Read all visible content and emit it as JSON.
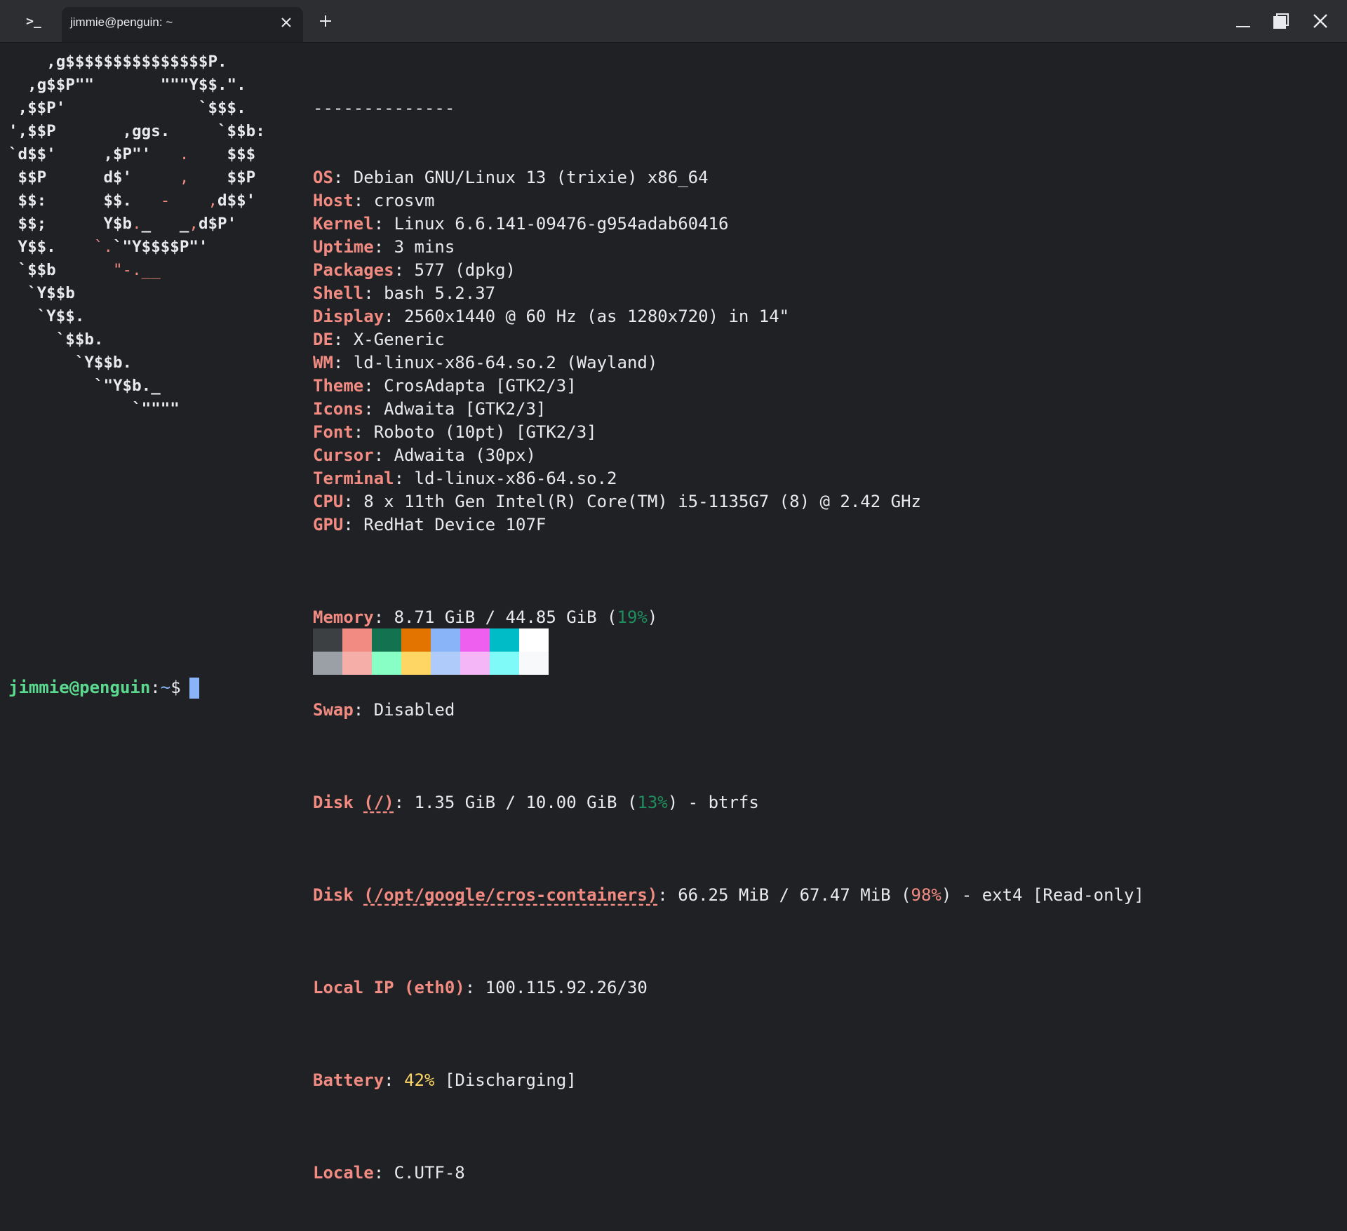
{
  "window": {
    "tab_title": "jimmie@penguin: ~",
    "app_icon": ">_"
  },
  "logo": {
    "lines": [
      "    ,g$$$$$$$$$$$$$$$P.",
      "  ,g$$P\"\"       \"\"\"Y$$.\".",
      " ,$$P'              `$$$.",
      "',$$P       ,ggs.     `$$b:",
      "`d$$'     ,$P\"'   .    $$$",
      " $$P      d$'     ,    $$P",
      " $$:      $$.   -    ,d$$'",
      " $$;      Y$b._   _,d$P'",
      " Y$$.    `.`\"Y$$$$P\"'",
      " `$$b      \"-.__",
      "  `Y$$b",
      "   `Y$$.",
      "     `$$b.",
      "       `Y$$b.",
      "         `\"Y$b._",
      "             `\"\"\"\""
    ]
  },
  "sysinfo": {
    "separator": "--------------",
    "rows": [
      {
        "label": "OS",
        "value": "Debian GNU/Linux 13 (trixie) x86_64"
      },
      {
        "label": "Host",
        "value": "crosvm"
      },
      {
        "label": "Kernel",
        "value": "Linux 6.6.141-09476-g954adab60416"
      },
      {
        "label": "Uptime",
        "value": "3 mins"
      },
      {
        "label": "Packages",
        "value": "577 (dpkg)"
      },
      {
        "label": "Shell",
        "value": "bash 5.2.37"
      },
      {
        "label": "Display",
        "value": "2560x1440 @ 60 Hz (as 1280x720) in 14\""
      },
      {
        "label": "DE",
        "value": "X-Generic"
      },
      {
        "label": "WM",
        "value": "ld-linux-x86-64.so.2 (Wayland)"
      },
      {
        "label": "Theme",
        "value": "CrosAdapta [GTK2/3]"
      },
      {
        "label": "Icons",
        "value": "Adwaita [GTK2/3]"
      },
      {
        "label": "Font",
        "value": "Roboto (10pt) [GTK2/3]"
      },
      {
        "label": "Cursor",
        "value": "Adwaita (30px)"
      },
      {
        "label": "Terminal",
        "value": "ld-linux-x86-64.so.2"
      },
      {
        "label": "CPU",
        "value": "8 x 11th Gen Intel(R) Core(TM) i5-1135G7 (8) @ 2.42 GHz"
      },
      {
        "label": "GPU",
        "value": "RedHat Device 107F"
      }
    ],
    "memory": {
      "label": "Memory",
      "pre": "8.71 GiB / 44.85 GiB (",
      "pct": "19%",
      "post": ")"
    },
    "swap": {
      "label": "Swap",
      "value": "Disabled"
    },
    "disk_root": {
      "label": "Disk",
      "mount": "(/)",
      "pre": "1.35 GiB / 10.00 GiB (",
      "pct": "13%",
      "post": ") - btrfs"
    },
    "disk_cros": {
      "label": "Disk",
      "mount": "(/opt/google/cros-containers)",
      "pre": "66.25 MiB / 67.47 MiB (",
      "pct": "98%",
      "post": ") - ext4 [Read-only]"
    },
    "local_ip": {
      "label": "Local IP",
      "iface": "(eth0)",
      "value": "100.115.92.26/30"
    },
    "battery": {
      "label": "Battery",
      "pct": "42%",
      "post": " [Discharging]"
    },
    "locale": {
      "label": "Locale",
      "value": "C.UTF-8"
    }
  },
  "palette": {
    "row1": [
      "#3c4043",
      "#f28b82",
      "#137351",
      "#e37400",
      "#8ab4f8",
      "#ee5ff0",
      "#00bcc7",
      "#ffffff"
    ],
    "row2": [
      "#9aa0a6",
      "#f6aea9",
      "#87ffc5",
      "#fdd663",
      "#aecbfa",
      "#f4b6f6",
      "#80f9f9",
      "#f8f9fa"
    ]
  },
  "prompt": {
    "user_host": "jimmie@penguin",
    "colon": ":",
    "path": "~",
    "symbol": "$"
  }
}
